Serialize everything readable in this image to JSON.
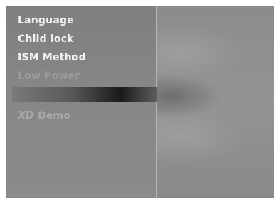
{
  "menu": {
    "items": [
      {
        "label": "Language"
      },
      {
        "label": "Child lock"
      },
      {
        "label": "ISM Method"
      },
      {
        "label": "Low Power"
      }
    ],
    "demo": {
      "logo": "XD",
      "label": "Demo"
    }
  }
}
